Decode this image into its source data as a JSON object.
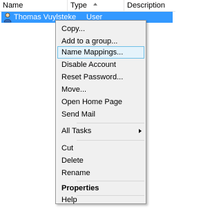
{
  "columns": {
    "name": "Name",
    "type": "Type",
    "description": "Description"
  },
  "row": {
    "name": "Thomas Vuylsteke",
    "type": "User",
    "icon": "user-icon"
  },
  "menu": {
    "copy": "Copy...",
    "add_to_group": "Add to a group...",
    "name_mappings": "Name Mappings...",
    "disable_account": "Disable Account",
    "reset_password": "Reset Password...",
    "move": "Move...",
    "open_home_page": "Open Home Page",
    "send_mail": "Send Mail",
    "all_tasks": "All Tasks",
    "cut": "Cut",
    "delete": "Delete",
    "rename": "Rename",
    "properties": "Properties",
    "help": "Help"
  },
  "colors": {
    "selection": "#3399ff",
    "menu_background": "#f0f0f0",
    "hover_background": "#e5f3fb",
    "hover_border": "#70c0e7"
  }
}
